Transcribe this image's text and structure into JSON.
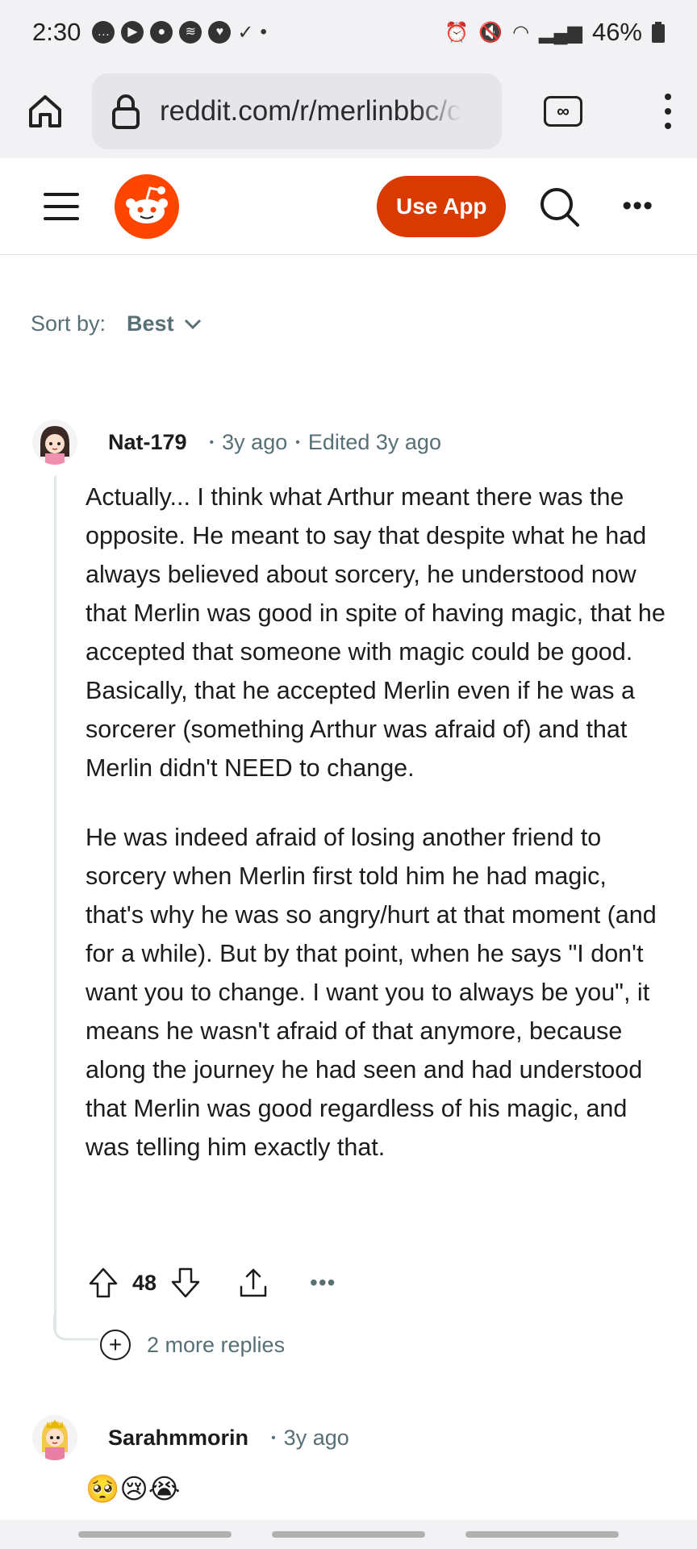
{
  "status": {
    "time": "2:30",
    "battery": "46%"
  },
  "browser": {
    "url": "reddit.com/r/merlinbbc/c",
    "tabs_count": "∞"
  },
  "header": {
    "use_app_label": "Use App",
    "more_label": "•••"
  },
  "sort": {
    "label": "Sort by:",
    "value": "Best"
  },
  "comments": [
    {
      "author": "Nat-179",
      "age": "3y ago",
      "edited": "Edited 3y ago",
      "paragraphs": [
        "Actually... I think what Arthur meant there was the opposite. He meant to say that despite what he had always believed about sorcery, he understood now that Merlin was good in spite of having magic, that he accepted that someone with magic could be good. Basically, that he accepted Merlin even if he was a sorcerer (something Arthur was afraid of) and that Merlin didn't NEED to change.",
        "He was indeed afraid of losing another friend to sorcery when Merlin first told him he had magic, that's why he was so angry/hurt at that moment (and for a while). But by that point, when he says \"I don't want you to change. I want you to always be you\", it means he wasn't afraid of that anymore, because along the journey he had seen and had understood that Merlin was good regardless of his magic, and was telling him exactly that."
      ],
      "score": "48",
      "more_label": "•••",
      "more_replies": "2 more replies"
    },
    {
      "author": "Sarahmmorin",
      "age": "3y ago",
      "text": "🥺😢😭"
    }
  ],
  "colors": {
    "accent": "#d93a00",
    "meta_text": "#576f76"
  }
}
